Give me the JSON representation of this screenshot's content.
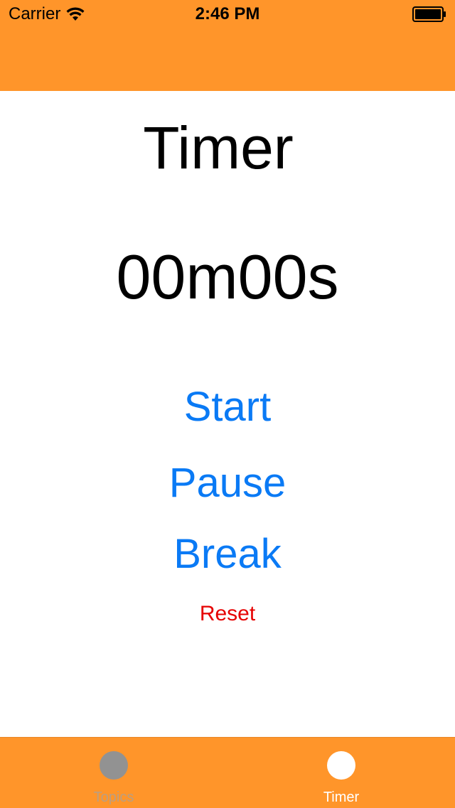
{
  "status_bar": {
    "carrier": "Carrier",
    "time": "2:46 PM",
    "wifi_icon": "wifi-icon",
    "battery_icon": "battery-icon"
  },
  "colors": {
    "accent": "#FF952A",
    "button_blue": "#0A7AF5",
    "reset_red": "#E60000",
    "inactive_tab": "#929292",
    "active_tab": "#FFFFFF"
  },
  "main": {
    "title": "Timer",
    "timer_value": "00m00s",
    "start_label": "Start",
    "pause_label": "Pause",
    "break_label": "Break",
    "reset_label": "Reset"
  },
  "tab_bar": {
    "tabs": [
      {
        "label": "Topics",
        "icon": "circle-icon",
        "selected": false
      },
      {
        "label": "Timer",
        "icon": "circle-icon",
        "selected": true
      }
    ]
  }
}
